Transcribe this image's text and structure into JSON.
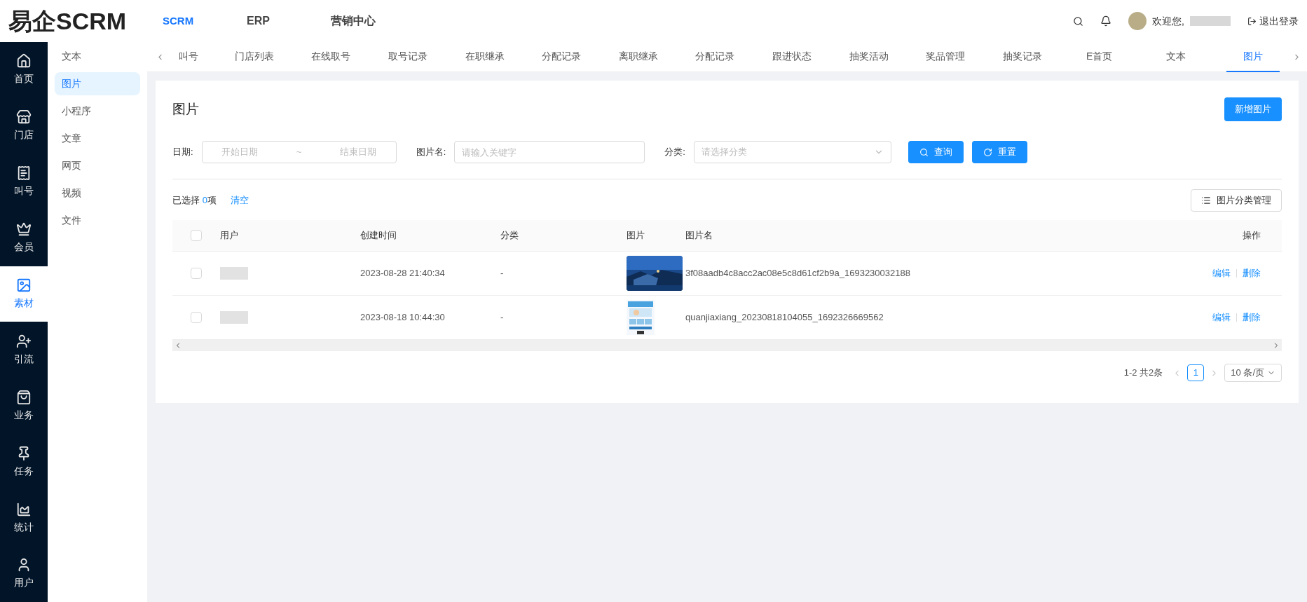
{
  "brand": "易企SCRM",
  "top_nav": [
    {
      "label": "SCRM",
      "selected": true
    },
    {
      "label": "ERP",
      "selected": false
    },
    {
      "label": "营销中心",
      "selected": false
    }
  ],
  "user": {
    "greeting": "欢迎您,",
    "logout": "退出登录"
  },
  "rail": [
    {
      "label": "首页",
      "selected": false
    },
    {
      "label": "门店",
      "selected": false
    },
    {
      "label": "叫号",
      "selected": false
    },
    {
      "label": "会员",
      "selected": false
    },
    {
      "label": "素材",
      "selected": true
    },
    {
      "label": "引流",
      "selected": false
    },
    {
      "label": "业务",
      "selected": false
    },
    {
      "label": "任务",
      "selected": false
    },
    {
      "label": "统计",
      "selected": false
    },
    {
      "label": "用户",
      "selected": false
    }
  ],
  "submenu": [
    {
      "label": "文本",
      "selected": false
    },
    {
      "label": "图片",
      "selected": true
    },
    {
      "label": "小程序",
      "selected": false
    },
    {
      "label": "文章",
      "selected": false
    },
    {
      "label": "网页",
      "selected": false
    },
    {
      "label": "视频",
      "selected": false
    },
    {
      "label": "文件",
      "selected": false
    }
  ],
  "tabs": [
    {
      "label": "叫号",
      "selected": false
    },
    {
      "label": "门店列表",
      "selected": false
    },
    {
      "label": "在线取号",
      "selected": false
    },
    {
      "label": "取号记录",
      "selected": false
    },
    {
      "label": "在职继承",
      "selected": false
    },
    {
      "label": "分配记录",
      "selected": false
    },
    {
      "label": "离职继承",
      "selected": false
    },
    {
      "label": "分配记录",
      "selected": false
    },
    {
      "label": "跟进状态",
      "selected": false
    },
    {
      "label": "抽奖活动",
      "selected": false
    },
    {
      "label": "奖品管理",
      "selected": false
    },
    {
      "label": "抽奖记录",
      "selected": false
    },
    {
      "label": "E首页",
      "selected": false
    },
    {
      "label": "文本",
      "selected": false
    },
    {
      "label": "图片",
      "selected": true
    }
  ],
  "page_title": "图片",
  "add_button": "新增图片",
  "filters": {
    "date_label": "日期:",
    "date_start_placeholder": "开始日期",
    "date_sep": "~",
    "date_end_placeholder": "结束日期",
    "name_label": "图片名:",
    "name_placeholder": "请输入关键字",
    "category_label": "分类:",
    "category_placeholder": "请选择分类",
    "search_button": "查询",
    "reset_button": "重置"
  },
  "selection": {
    "prefix": "已选择",
    "count": "0",
    "suffix": "项",
    "clear": "清空"
  },
  "category_manage_button": "图片分类管理",
  "table": {
    "select_all_checked": false,
    "columns": [
      "用户",
      "创建时间",
      "分类",
      "图片",
      "图片名",
      "操作"
    ],
    "rows": [
      {
        "checked": false,
        "created": "2023-08-28 21:40:34",
        "category": "-",
        "image": {
          "kind": "picture"
        },
        "name": "3f08aadb4c8acc2ac08e5c8d61cf2b9a_1693230032188",
        "actions": [
          "编辑",
          "删除"
        ]
      },
      {
        "checked": false,
        "created": "2023-08-18 10:44:30",
        "category": "-",
        "image": {
          "kind": "picture"
        },
        "name": "quanjiaxiang_20230818104055_1692326669562",
        "actions": [
          "编辑",
          "删除"
        ]
      }
    ]
  },
  "pagination": {
    "summary": "1-2 共2条",
    "pages": [
      {
        "label": "1",
        "selected": true
      }
    ],
    "page_size": "10 条/页"
  }
}
